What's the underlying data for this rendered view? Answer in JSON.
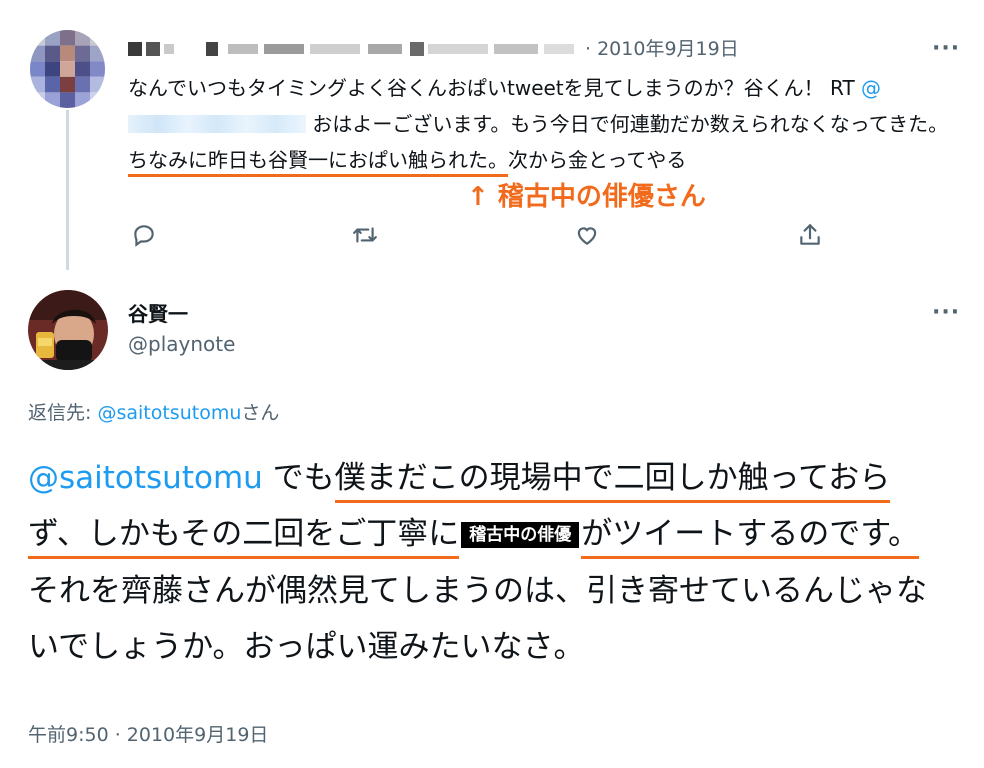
{
  "quoted_tweet": {
    "separator": "·",
    "date": "2010年9月19日",
    "more_icon": "more-dots-icon",
    "text_part1": "なんでいつもタイミングよく谷くんおぱいtweetを見てしまうのか？谷くん！ RT ",
    "mention_prefix": "@",
    "text_part2": " おはよーございます。もう今日で何連勤だか数えられなくなってきた。",
    "highlight": "ちなみに昨日も谷賢一におぱい触られた。",
    "text_part3": "次から金とってやる",
    "annotation": "↑ 稽古中の俳優さん",
    "actions": [
      "reply-icon",
      "retweet-icon",
      "like-icon",
      "share-icon"
    ]
  },
  "reply_tweet": {
    "author_name": "谷賢一",
    "author_handle": "@playnote",
    "reply_to_label": "返信先: ",
    "reply_to_handle": "@saitotsutomu",
    "reply_to_suffix": "さん",
    "mention": "@saitotsutomu",
    "seg1": " でも",
    "hl1": "僕まだこの現場中で二回しか触っておらず、しかもその二回をご丁寧に",
    "label_box": "稽古中の俳優",
    "seg2": "がツイートするのです。",
    "seg3": "それを齊藤さんが偶然見てしまうのは、引き寄せているんじゃないでしょうか。おっぱい運みたいなさ。",
    "timestamp": "午前9:50 · 2010年9月19日"
  },
  "colors": {
    "accent_orange": "#f26b1d",
    "link_blue": "#1d9bf0",
    "muted_gray": "#536471"
  }
}
